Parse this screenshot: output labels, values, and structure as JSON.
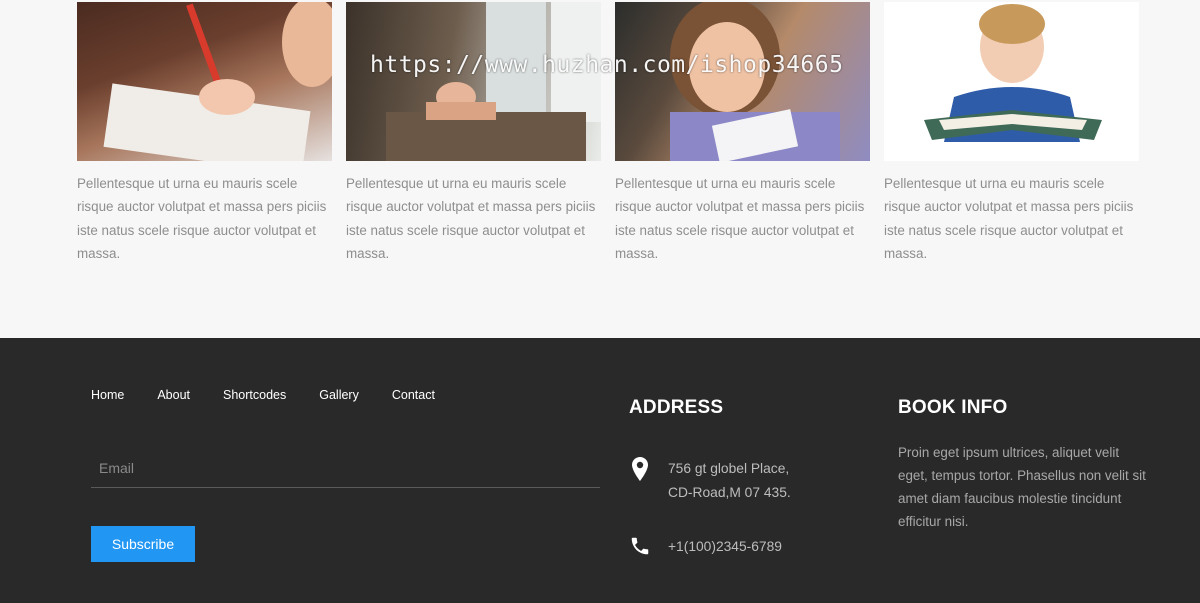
{
  "gallery": {
    "cards": [
      {
        "image": "child-writing-with-red-pencil",
        "caption": "Pellentesque ut urna eu mauris scele risque auctor volutpat et massa pers piciis iste natus scele risque auctor volutpat et massa."
      },
      {
        "image": "child-resting-at-school-desk",
        "caption": "Pellentesque ut urna eu mauris scele risque auctor volutpat et massa pers piciis iste natus scele risque auctor volutpat et massa."
      },
      {
        "image": "girl-writing-in-notebook",
        "caption": "Pellentesque ut urna eu mauris scele risque auctor volutpat et massa pers piciis iste natus scele risque auctor volutpat et massa."
      },
      {
        "image": "boy-reading-book",
        "caption": "Pellentesque ut urna eu mauris scele risque auctor volutpat et massa pers piciis iste natus scele risque auctor volutpat et massa."
      }
    ],
    "watermark": "https://www.huzhan.com/ishop34665"
  },
  "footer": {
    "nav": [
      "Home",
      "About",
      "Shortcodes",
      "Gallery",
      "Contact"
    ],
    "email_placeholder": "Email",
    "subscribe_label": "Subscribe",
    "address": {
      "title": "ADDRESS",
      "line1": "756 gt globel Place,",
      "line2": "CD-Road,M 07 435.",
      "phone": "+1(100)2345-6789"
    },
    "book_info": {
      "title": "BOOK INFO",
      "text": "Proin eget ipsum ultrices, aliquet velit eget, tempus tortor. Phasellus non velit sit amet diam faucibus molestie tincidunt efficitur nisi."
    }
  },
  "colors": {
    "footer_bg": "#292929",
    "page_bg": "#f7f7f8",
    "accent": "#2196f3"
  },
  "icons": [
    "map-pin-icon",
    "phone-icon"
  ]
}
